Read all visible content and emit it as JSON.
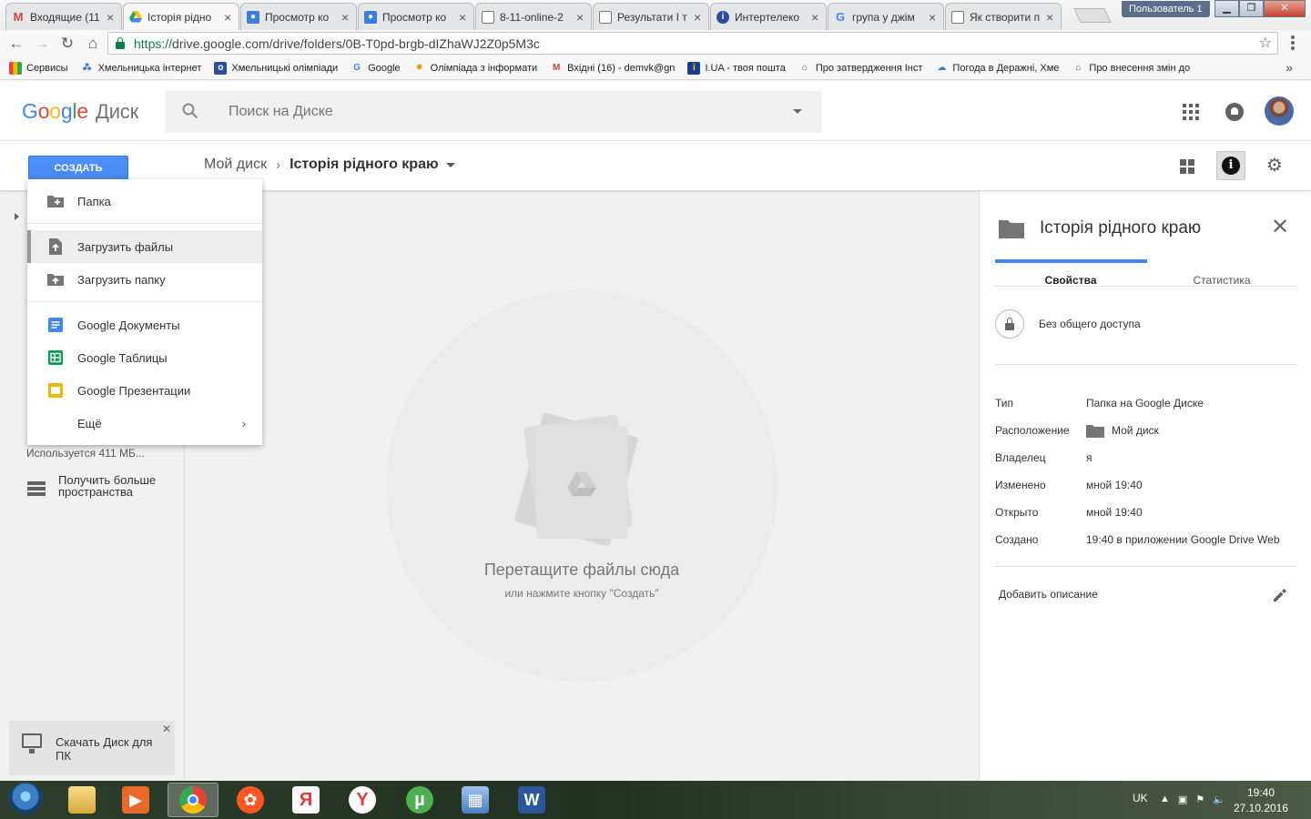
{
  "browser": {
    "tabs": [
      {
        "title": "Входящие (11",
        "favicon": "gmail",
        "color": "#d44638"
      },
      {
        "title": "Історія рідно",
        "favicon": "drive",
        "color": "#1fa463",
        "active": true
      },
      {
        "title": "Просмотр ко",
        "favicon": "contact",
        "color": "#3b7dd8"
      },
      {
        "title": "Просмотр ко",
        "favicon": "contact",
        "color": "#3b7dd8"
      },
      {
        "title": "8-11-online-2",
        "favicon": "page",
        "color": "#888888"
      },
      {
        "title": "Результати І т",
        "favicon": "page",
        "color": "#888888"
      },
      {
        "title": "Интертелеко",
        "favicon": "intertelecom",
        "color": "#2a4d9b"
      },
      {
        "title": "група у джім",
        "favicon": "google",
        "color": "#4285f4"
      },
      {
        "title": "Як створити п",
        "favicon": "page",
        "color": "#888888"
      }
    ],
    "user_label": "Пользователь 1",
    "url_scheme": "https://",
    "url_rest": "drive.google.com/drive/folders/0B-T0pd-brgb-dIZhaWJ2Z0p5M3c",
    "bookmarks": [
      {
        "label": "Сервисы",
        "icon": "apps-icon"
      },
      {
        "label": "Хмельницька інтернет",
        "icon": "site-icon"
      },
      {
        "label": "Хмельницькі олімпіади",
        "icon": "site-icon"
      },
      {
        "label": "Google",
        "icon": "google-icon"
      },
      {
        "label": "Олімпіада з інформати",
        "icon": "site-icon"
      },
      {
        "label": "Вхідні (16) - demvk@gn",
        "icon": "gmail-icon"
      },
      {
        "label": "I.UA - твоя пошта",
        "icon": "iua-icon"
      },
      {
        "label": "Про затвердження Інст",
        "icon": "gov-icon"
      },
      {
        "label": "Погода в Деражні, Хме",
        "icon": "weather-icon"
      },
      {
        "label": "Про внесення змін до",
        "icon": "gov-icon"
      }
    ]
  },
  "drive": {
    "logo_product": "Диск",
    "search_placeholder": "Поиск на Диске",
    "create_label": "СОЗДАТЬ",
    "breadcrumb_root": "Мой диск",
    "breadcrumb_current": "Історія рідного краю",
    "create_menu": {
      "folder": "Папка",
      "upload_files": "Загрузить файлы",
      "upload_folder": "Загрузить папку",
      "docs": "Google Документы",
      "sheets": "Google Таблицы",
      "slides": "Google Презентации",
      "more": "Ещё"
    },
    "storage_used": "Используется 411 МБ...",
    "get_more_storage": "Получить больше пространства",
    "download_drive": "Скачать Диск для ПК",
    "drop_title": "Перетащите файлы сюда",
    "drop_subtitle": "или нажмите кнопку \"Создать\""
  },
  "details": {
    "title": "Історія рідного краю",
    "tab_properties": "Свойства",
    "tab_stats": "Статистика",
    "sharing": "Без общего доступа",
    "props": [
      {
        "key": "Тип",
        "value": "Папка на Google Диске"
      },
      {
        "key": "Расположение",
        "value": "Мой диск",
        "folder": true
      },
      {
        "key": "Владелец",
        "value": "я"
      },
      {
        "key": "Изменено",
        "value": "мной 19:40"
      },
      {
        "key": "Открыто",
        "value": "мной 19:40"
      },
      {
        "key": "Создано",
        "value": "19:40 в приложении Google Drive Web"
      }
    ],
    "add_description": "Добавить описание"
  },
  "taskbar": {
    "apps": [
      {
        "name": "explorer",
        "color": "#e8c25a"
      },
      {
        "name": "media-player",
        "color": "#e86a2a"
      },
      {
        "name": "chrome",
        "color": "#34a853",
        "active": true
      },
      {
        "name": "media-center",
        "color": "#ff5722"
      },
      {
        "name": "yandex-browser",
        "color": "#e53935"
      },
      {
        "name": "yandex",
        "color": "#e53935"
      },
      {
        "name": "utorrent",
        "color": "#4caf50"
      },
      {
        "name": "control-panel",
        "color": "#5a86c5"
      },
      {
        "name": "word",
        "color": "#2b579a"
      }
    ],
    "lang": "UK",
    "time": "19:40",
    "date": "27.10.2016"
  },
  "colors": {
    "create_button": "#4d90fe",
    "tab_indicator": "#4285f4",
    "docs": "#4285f4",
    "sheets": "#0f9d58",
    "slides": "#f4b400"
  }
}
